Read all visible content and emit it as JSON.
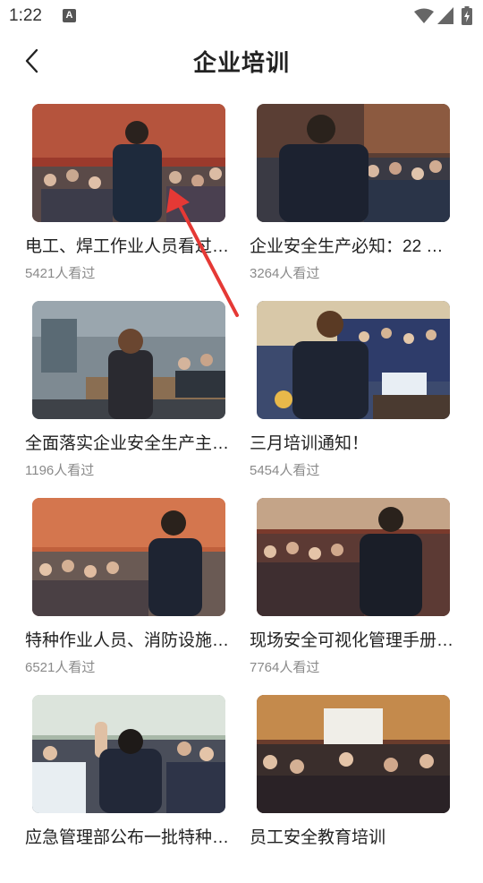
{
  "status_bar": {
    "time": "1:22",
    "notification_icon": "A"
  },
  "header": {
    "title": "企业培训",
    "back_icon": "chevron-left-icon"
  },
  "articles": [
    {
      "title": "电工、焊工作业人员看过…",
      "views": "5421人看过"
    },
    {
      "title": "企业安全生产必知：22 种…",
      "views": "3264人看过"
    },
    {
      "title": "全面落实企业安全生产主…",
      "views": "1196人看过"
    },
    {
      "title": "三月培训通知！",
      "views": "5454人看过"
    },
    {
      "title": "特种作业人员、消防设施…",
      "views": "6521人看过"
    },
    {
      "title": "现场安全可视化管理手册…",
      "views": "7764人看过"
    },
    {
      "title": "应急管理部公布一批特种…",
      "views": ""
    },
    {
      "title": "员工安全教育培训",
      "views": ""
    }
  ],
  "colors": {
    "accent_arrow": "#e53935",
    "muted_text": "#8a8a8a"
  }
}
